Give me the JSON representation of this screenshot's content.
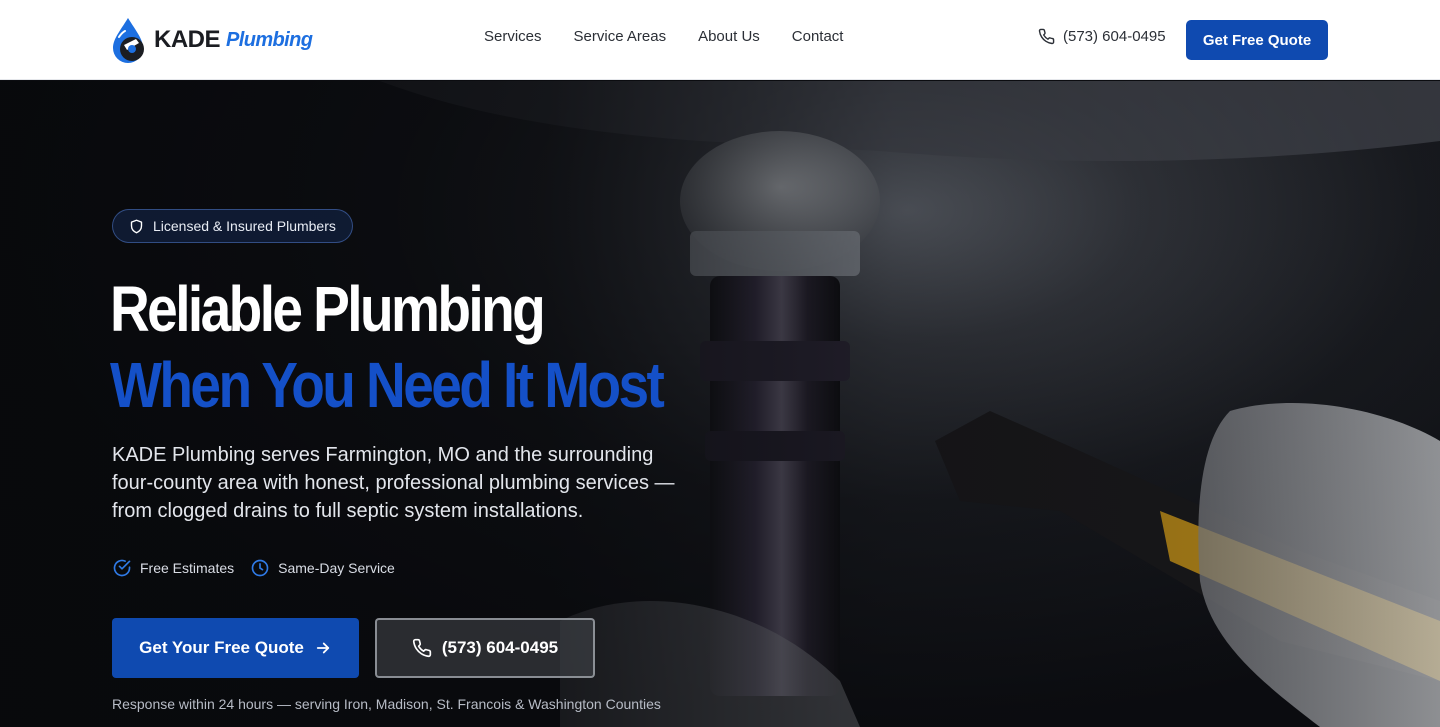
{
  "brand": {
    "name_primary": "KADE",
    "name_secondary": "Plumbing",
    "logo_colors": {
      "dark": "#1b1d22",
      "accent": "#1d6fe0"
    }
  },
  "nav": {
    "items": [
      {
        "label": "Services"
      },
      {
        "label": "Service Areas"
      },
      {
        "label": "About Us"
      },
      {
        "label": "Contact"
      }
    ]
  },
  "header": {
    "phone": "(573) 604-0495",
    "phone_icon": "phone-icon",
    "cta_label": "Get Free Quote"
  },
  "hero": {
    "badge": {
      "icon": "shield-icon",
      "label": "Licensed & Insured Plumbers"
    },
    "heading_line1": "Reliable Plumbing",
    "heading_line2": "When You Need It Most",
    "lead": "KADE Plumbing serves Farmington, MO and the surrounding four-county area with honest, professional plumbing services — from clogged drains to full septic system installations.",
    "features": [
      {
        "icon": "check-circle-icon",
        "label": "Free Estimates"
      },
      {
        "icon": "clock-icon",
        "label": "Same-Day Service"
      }
    ],
    "primary_cta": {
      "label": "Get Your Free Quote",
      "icon": "arrow-right-icon"
    },
    "secondary_cta": {
      "label": "(573) 604-0495",
      "icon": "phone-icon"
    },
    "response_note": "Response within 24 hours — serving Iron, Madison, St. Francois & Washington Counties"
  },
  "colors": {
    "primary_blue": "#0f4ab0",
    "heading_blue": "#1450c8",
    "white": "#ffffff"
  }
}
